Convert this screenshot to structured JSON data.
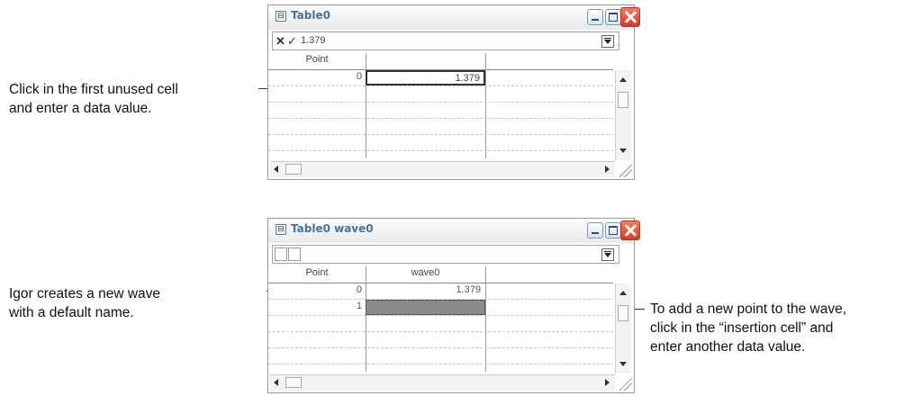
{
  "annotations": {
    "first_cell": [
      "Click in the first unused cell",
      "and enter a data value."
    ],
    "new_wave": [
      "Igor creates a new wave",
      "with a default name."
    ],
    "insertion": [
      "To add a new point to the wave,",
      "click in the “insertion cell” and",
      "enter another data value."
    ]
  },
  "window1": {
    "title": "Table0",
    "entry_value": "1.379",
    "column_header": "Point",
    "row_index": "0",
    "cell_value": "1.379"
  },
  "window2": {
    "title": "Table0 wave0",
    "column_header_point": "Point",
    "column_header_wave": "wave0",
    "rows": [
      {
        "index": "0",
        "value": "1.379"
      },
      {
        "index": "1",
        "value": ""
      }
    ]
  },
  "icons": {
    "cancel": "cancel-x-icon",
    "accept": "accept-check-icon",
    "menu": "table-menu-icon",
    "minimize": "minimize-icon",
    "maximize": "maximize-icon",
    "close": "close-icon"
  },
  "colors": {
    "title_text": "#4a6fa7",
    "close_button": "#d83a1f",
    "insertion_cell": "#8a8a8a"
  }
}
